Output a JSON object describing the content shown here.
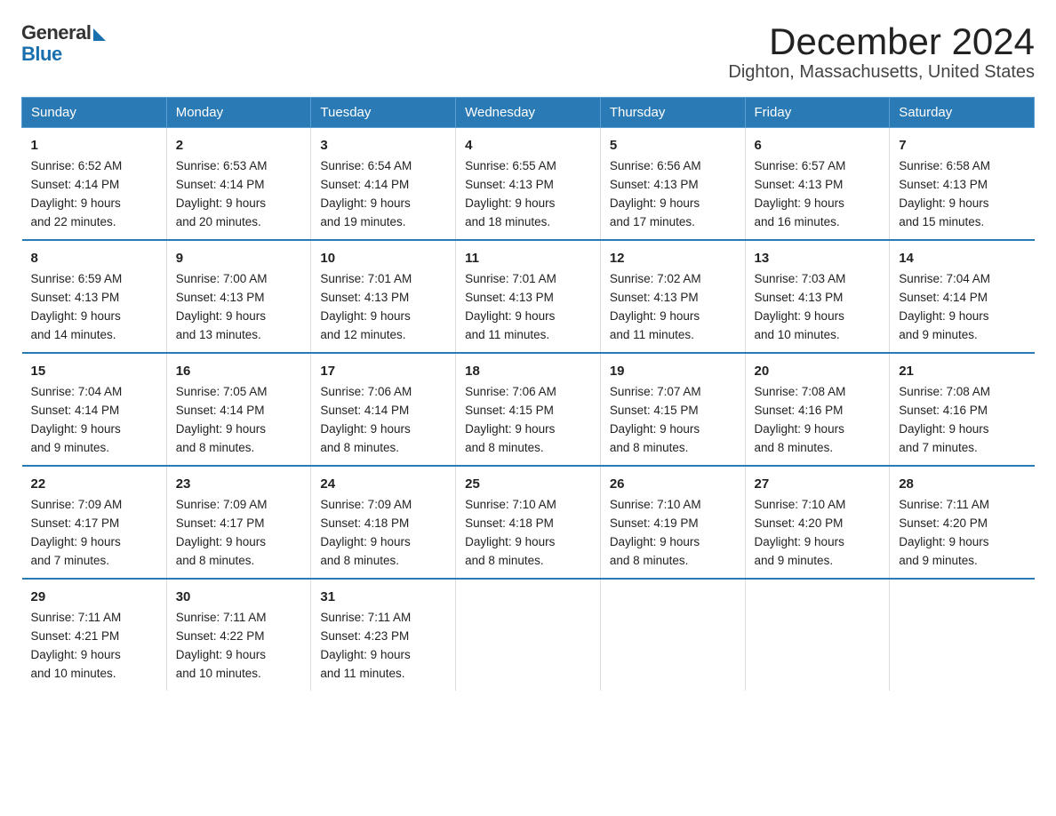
{
  "header": {
    "logo_general": "General",
    "logo_blue": "Blue",
    "title": "December 2024",
    "subtitle": "Dighton, Massachusetts, United States"
  },
  "weekdays": [
    "Sunday",
    "Monday",
    "Tuesday",
    "Wednesday",
    "Thursday",
    "Friday",
    "Saturday"
  ],
  "weeks": [
    [
      {
        "day": "1",
        "sunrise": "6:52 AM",
        "sunset": "4:14 PM",
        "daylight": "9 hours and 22 minutes."
      },
      {
        "day": "2",
        "sunrise": "6:53 AM",
        "sunset": "4:14 PM",
        "daylight": "9 hours and 20 minutes."
      },
      {
        "day": "3",
        "sunrise": "6:54 AM",
        "sunset": "4:14 PM",
        "daylight": "9 hours and 19 minutes."
      },
      {
        "day": "4",
        "sunrise": "6:55 AM",
        "sunset": "4:13 PM",
        "daylight": "9 hours and 18 minutes."
      },
      {
        "day": "5",
        "sunrise": "6:56 AM",
        "sunset": "4:13 PM",
        "daylight": "9 hours and 17 minutes."
      },
      {
        "day": "6",
        "sunrise": "6:57 AM",
        "sunset": "4:13 PM",
        "daylight": "9 hours and 16 minutes."
      },
      {
        "day": "7",
        "sunrise": "6:58 AM",
        "sunset": "4:13 PM",
        "daylight": "9 hours and 15 minutes."
      }
    ],
    [
      {
        "day": "8",
        "sunrise": "6:59 AM",
        "sunset": "4:13 PM",
        "daylight": "9 hours and 14 minutes."
      },
      {
        "day": "9",
        "sunrise": "7:00 AM",
        "sunset": "4:13 PM",
        "daylight": "9 hours and 13 minutes."
      },
      {
        "day": "10",
        "sunrise": "7:01 AM",
        "sunset": "4:13 PM",
        "daylight": "9 hours and 12 minutes."
      },
      {
        "day": "11",
        "sunrise": "7:01 AM",
        "sunset": "4:13 PM",
        "daylight": "9 hours and 11 minutes."
      },
      {
        "day": "12",
        "sunrise": "7:02 AM",
        "sunset": "4:13 PM",
        "daylight": "9 hours and 11 minutes."
      },
      {
        "day": "13",
        "sunrise": "7:03 AM",
        "sunset": "4:13 PM",
        "daylight": "9 hours and 10 minutes."
      },
      {
        "day": "14",
        "sunrise": "7:04 AM",
        "sunset": "4:14 PM",
        "daylight": "9 hours and 9 minutes."
      }
    ],
    [
      {
        "day": "15",
        "sunrise": "7:04 AM",
        "sunset": "4:14 PM",
        "daylight": "9 hours and 9 minutes."
      },
      {
        "day": "16",
        "sunrise": "7:05 AM",
        "sunset": "4:14 PM",
        "daylight": "9 hours and 8 minutes."
      },
      {
        "day": "17",
        "sunrise": "7:06 AM",
        "sunset": "4:14 PM",
        "daylight": "9 hours and 8 minutes."
      },
      {
        "day": "18",
        "sunrise": "7:06 AM",
        "sunset": "4:15 PM",
        "daylight": "9 hours and 8 minutes."
      },
      {
        "day": "19",
        "sunrise": "7:07 AM",
        "sunset": "4:15 PM",
        "daylight": "9 hours and 8 minutes."
      },
      {
        "day": "20",
        "sunrise": "7:08 AM",
        "sunset": "4:16 PM",
        "daylight": "9 hours and 8 minutes."
      },
      {
        "day": "21",
        "sunrise": "7:08 AM",
        "sunset": "4:16 PM",
        "daylight": "9 hours and 7 minutes."
      }
    ],
    [
      {
        "day": "22",
        "sunrise": "7:09 AM",
        "sunset": "4:17 PM",
        "daylight": "9 hours and 7 minutes."
      },
      {
        "day": "23",
        "sunrise": "7:09 AM",
        "sunset": "4:17 PM",
        "daylight": "9 hours and 8 minutes."
      },
      {
        "day": "24",
        "sunrise": "7:09 AM",
        "sunset": "4:18 PM",
        "daylight": "9 hours and 8 minutes."
      },
      {
        "day": "25",
        "sunrise": "7:10 AM",
        "sunset": "4:18 PM",
        "daylight": "9 hours and 8 minutes."
      },
      {
        "day": "26",
        "sunrise": "7:10 AM",
        "sunset": "4:19 PM",
        "daylight": "9 hours and 8 minutes."
      },
      {
        "day": "27",
        "sunrise": "7:10 AM",
        "sunset": "4:20 PM",
        "daylight": "9 hours and 9 minutes."
      },
      {
        "day": "28",
        "sunrise": "7:11 AM",
        "sunset": "4:20 PM",
        "daylight": "9 hours and 9 minutes."
      }
    ],
    [
      {
        "day": "29",
        "sunrise": "7:11 AM",
        "sunset": "4:21 PM",
        "daylight": "9 hours and 10 minutes."
      },
      {
        "day": "30",
        "sunrise": "7:11 AM",
        "sunset": "4:22 PM",
        "daylight": "9 hours and 10 minutes."
      },
      {
        "day": "31",
        "sunrise": "7:11 AM",
        "sunset": "4:23 PM",
        "daylight": "9 hours and 11 minutes."
      },
      null,
      null,
      null,
      null
    ]
  ],
  "labels": {
    "sunrise": "Sunrise:",
    "sunset": "Sunset:",
    "daylight": "Daylight:"
  }
}
